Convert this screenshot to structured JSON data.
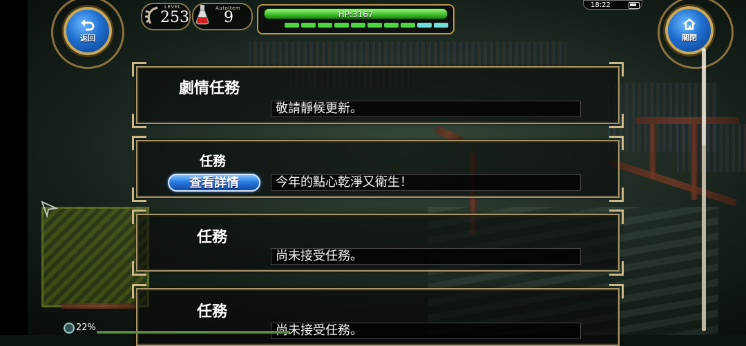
{
  "hud": {
    "back_label": "返回",
    "close_label": "關閉",
    "level_caption": "LEVEL",
    "level_value": "253",
    "autoitem_caption": "AutoItem",
    "autoitem_value": "9",
    "hp_text": "HP:3167",
    "hp_fill_fraction": 1.0,
    "sp_segments": 10,
    "sp_segments_cyan": 2,
    "clock": "18:22"
  },
  "quests": [
    {
      "title": "劇情任務",
      "description": "敬請靜候更新。",
      "has_detail_button": false
    },
    {
      "title": "任務",
      "description": "今年的點心乾淨又衛生！",
      "has_detail_button": true,
      "detail_label": "查看詳情"
    },
    {
      "title": "任務",
      "description": "尚未接受任務。",
      "has_detail_button": false
    },
    {
      "title": "任務",
      "description": "尚未接受任務。",
      "has_detail_button": false
    }
  ],
  "footer": {
    "progress_text": "22%"
  },
  "icons": {
    "back": "back-arrow-icon",
    "close": "home-icon",
    "level": "laurel-icon",
    "autoitem": "potion-flask-icon",
    "side": "send-arrow-icon",
    "footer": "gear-icon"
  },
  "colors": {
    "accent_blue": "#2a7be0",
    "hp_green": "#3fbf2b",
    "frame_gold": "#b8964f"
  }
}
